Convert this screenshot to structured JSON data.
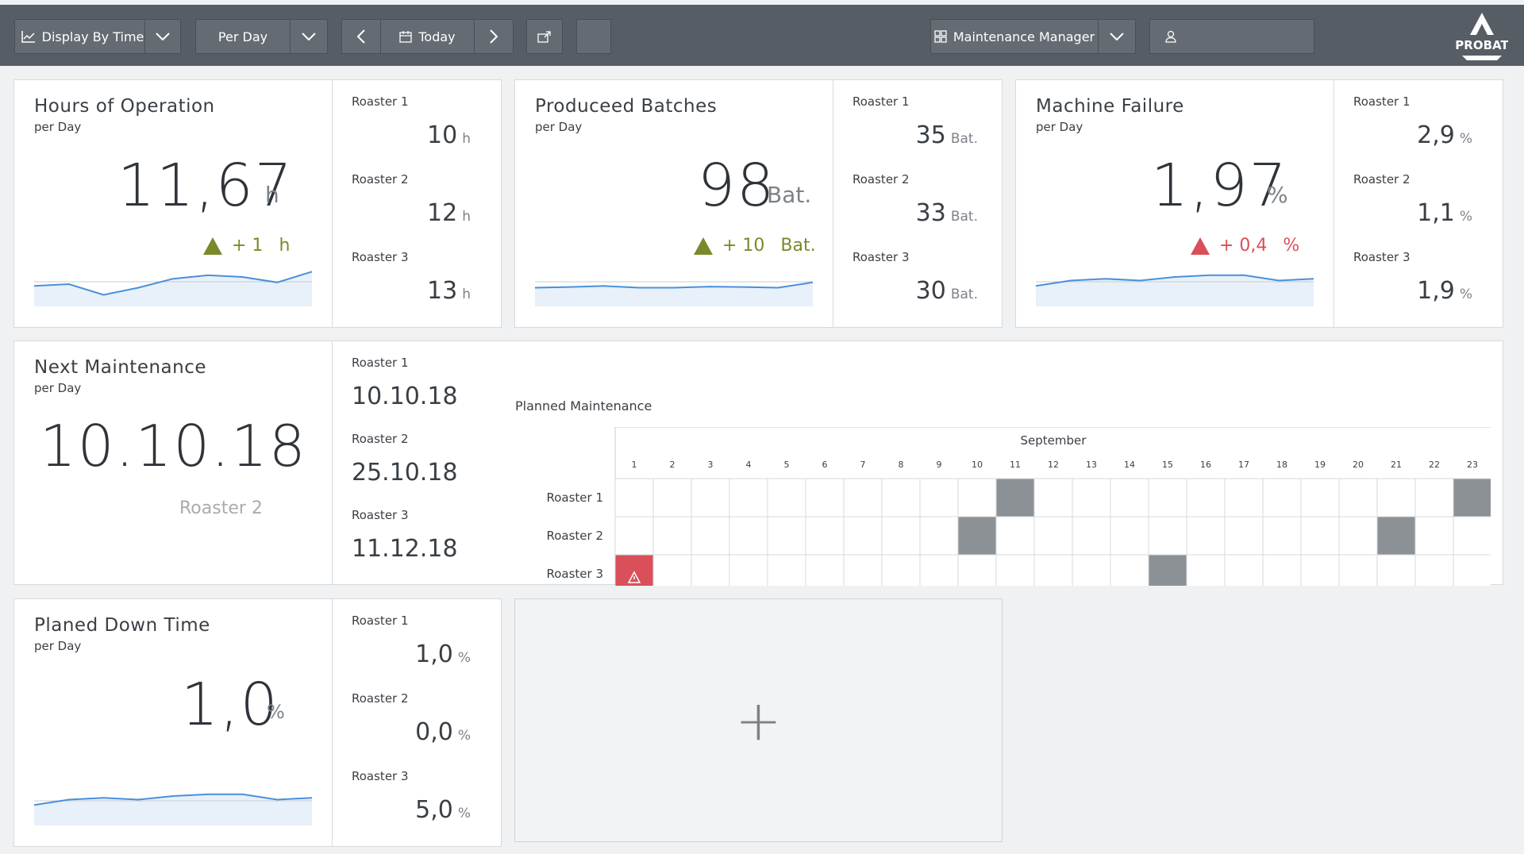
{
  "toolbar": {
    "display_mode": "Display By Time",
    "period": "Per Day",
    "date": "Today",
    "role": "Maintenance Manager",
    "user": ""
  },
  "logo_text": "PROBAT",
  "cards": {
    "hours": {
      "title": "Hours of Operation",
      "sub": "per Day",
      "value": "11,67",
      "unit": "h",
      "delta": "+ 1",
      "delta_unit": "h",
      "delta_color": "#7a8a2a",
      "roasters": [
        {
          "label": "Roaster 1",
          "value": "10",
          "unit": "h"
        },
        {
          "label": "Roaster 2",
          "value": "12",
          "unit": "h"
        },
        {
          "label": "Roaster 3",
          "value": "13",
          "unit": "h"
        }
      ]
    },
    "batches": {
      "title": "Produceed Batches",
      "sub": "per Day",
      "value": "98",
      "unit": "Bat.",
      "delta": "+ 10",
      "delta_unit": "Bat.",
      "delta_color": "#7a8a2a",
      "roasters": [
        {
          "label": "Roaster 1",
          "value": "35",
          "unit": "Bat."
        },
        {
          "label": "Roaster 2",
          "value": "33",
          "unit": "Bat."
        },
        {
          "label": "Roaster 3",
          "value": "30",
          "unit": "Bat."
        }
      ]
    },
    "failure": {
      "title": "Machine Failure",
      "sub": "per Day",
      "value": "1,97",
      "unit": "%",
      "delta": "+ 0,4",
      "delta_unit": "%",
      "delta_color": "#d9505a",
      "roasters": [
        {
          "label": "Roaster 1",
          "value": "2,9",
          "unit": "%"
        },
        {
          "label": "Roaster 2",
          "value": "1,1",
          "unit": "%"
        },
        {
          "label": "Roaster 3",
          "value": "1,9",
          "unit": "%"
        }
      ]
    },
    "maintenance": {
      "title": "Next Maintenance",
      "sub": "per Day",
      "value": "10.10.18",
      "target": "Roaster 2",
      "roasters": [
        {
          "label": "Roaster 1",
          "value": "10.10.18"
        },
        {
          "label": "Roaster 2",
          "value": "25.10.18"
        },
        {
          "label": "Roaster 3",
          "value": "11.12.18"
        }
      ]
    },
    "downtime": {
      "title": "Planed Down Time",
      "sub": "per Day",
      "value": "1,0",
      "unit": "%",
      "roasters": [
        {
          "label": "Roaster 1",
          "value": "1,0",
          "unit": "%"
        },
        {
          "label": "Roaster 2",
          "value": "0,0",
          "unit": "%"
        },
        {
          "label": "Roaster 3",
          "value": "5,0",
          "unit": "%"
        }
      ]
    }
  },
  "calendar": {
    "title": "Planned Maintenance",
    "month": "September",
    "days": [
      "1",
      "2",
      "3",
      "4",
      "5",
      "6",
      "7",
      "8",
      "9",
      "10",
      "11",
      "12",
      "13",
      "14",
      "15",
      "16",
      "17",
      "18",
      "19",
      "20",
      "21",
      "22",
      "23"
    ],
    "rows": [
      {
        "label": "Roaster 1",
        "scheduled": [
          11,
          23
        ],
        "alerts": []
      },
      {
        "label": "Roaster 2",
        "scheduled": [
          10,
          21
        ],
        "alerts": []
      },
      {
        "label": "Roaster 3",
        "scheduled": [
          15
        ],
        "alerts": [
          1
        ]
      }
    ],
    "scheduled_color": "#8c9196",
    "alert_color": "#d9505a"
  },
  "add_widget": "+",
  "sparklines": {
    "hours": [
      0.35,
      0.4,
      0.1,
      0.3,
      0.55,
      0.65,
      0.6,
      0.45,
      0.75
    ],
    "batches": [
      0.3,
      0.32,
      0.35,
      0.3,
      0.3,
      0.33,
      0.32,
      0.3,
      0.45
    ],
    "failure": [
      0.35,
      0.5,
      0.55,
      0.5,
      0.6,
      0.65,
      0.65,
      0.5,
      0.55
    ],
    "downtime": [
      0.35,
      0.5,
      0.55,
      0.5,
      0.6,
      0.65,
      0.65,
      0.5,
      0.55
    ]
  }
}
